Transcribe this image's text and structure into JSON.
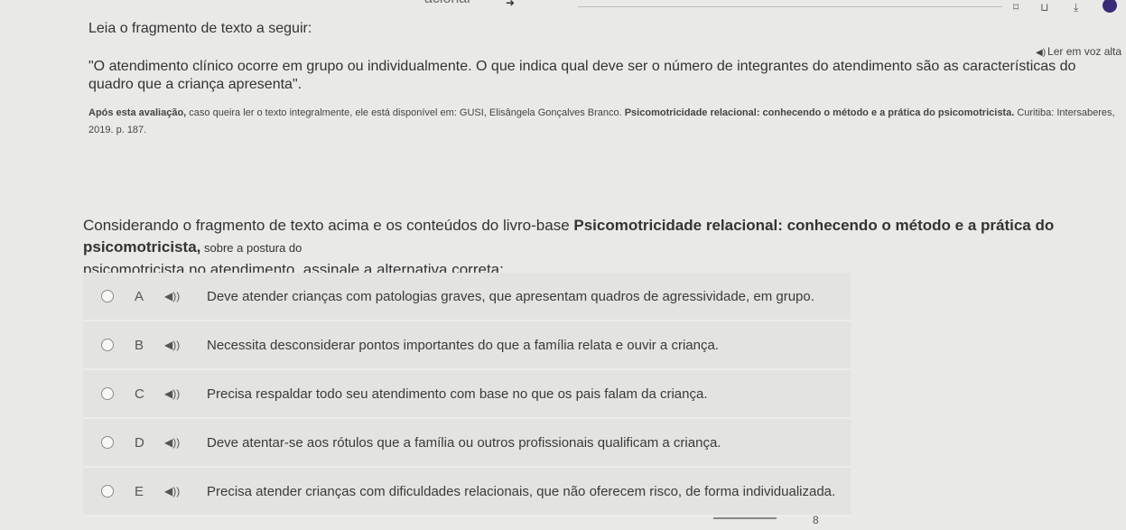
{
  "intro": "Leia o fragmento de texto a seguir:",
  "read_aloud": {
    "icon": "speaker-icon",
    "label": "Ler em voz alta"
  },
  "quote": "\"O atendimento clínico ocorre em grupo ou individualmente. O que indica qual deve ser o número de integrantes do atendimento são as características do quadro que a criança apresenta\".",
  "source": {
    "lead": "Após esta avaliação,",
    "rest": "caso queira ler o texto integralmente, ele está disponível em: GUSI, Elisângela Gonçalves Branco. ",
    "book": "Psicomotricidade relacional: conhecendo o método e a prática do psicomotricista.",
    "publisher": " Curitiba: Intersaberes, 2019. p. 187."
  },
  "prompt": {
    "before": "Considerando o fragmento de texto acima e os conteúdos do livro-base ",
    "book": "Psicomotricidade relacional: conhecendo o método e a prática do psicomotricista,",
    "tail": " sobre a postura do",
    "after": " psicomotricista no atendimento, assinale a alternativa correta:"
  },
  "options": [
    {
      "letter": "A",
      "text": "Deve atender crianças com patologias graves, que apresentam quadros de agressividade, em grupo."
    },
    {
      "letter": "B",
      "text": "Necessita desconsiderar pontos importantes do que a família relata e ouvir a criança."
    },
    {
      "letter": "C",
      "text": "Precisa respaldar todo seu atendimento com base no que os pais falam da criança."
    },
    {
      "letter": "D",
      "text": "Deve atentar-se aos rótulos que a família ou outros profissionais qualificam a criança."
    },
    {
      "letter": "E",
      "text": "Precisa atender crianças com dificuldades relacionais, que não oferecem risco, de forma individualizada."
    }
  ],
  "top": {
    "partial": "acional"
  },
  "bottom": {
    "mark": "8"
  }
}
